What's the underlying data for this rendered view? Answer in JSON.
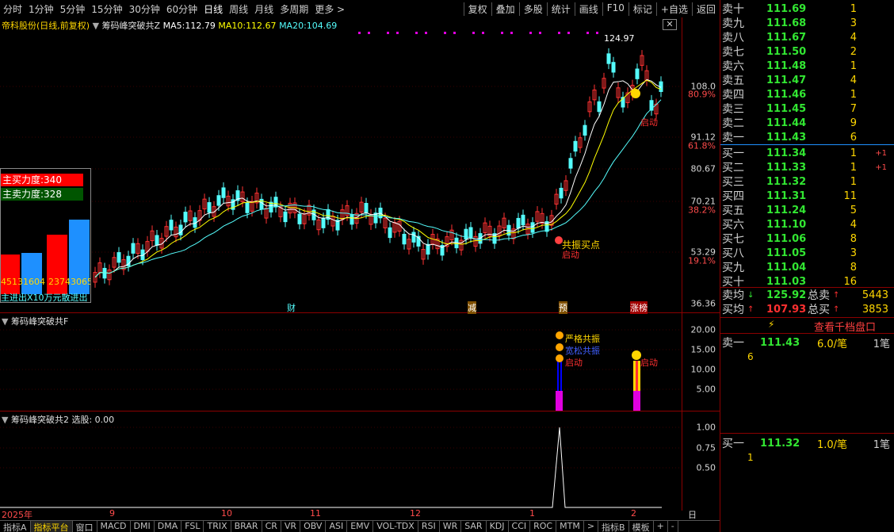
{
  "toolbar": {
    "left": [
      "分时",
      "1分钟",
      "5分钟",
      "15分钟",
      "30分钟",
      "60分钟",
      "日线",
      "周线",
      "月线",
      "多周期",
      "更多 >"
    ],
    "active": "日线",
    "right": [
      "复权",
      "叠加",
      "多股",
      "统计",
      "画线",
      "F10",
      "标记",
      "+自选",
      "返回"
    ]
  },
  "main_pane": {
    "title_stock": "帝科股份(日线,前复权)",
    "indicator": "筹码峰突破共Z",
    "ma5_label": "MA5:",
    "ma5": "112.79",
    "ma10_label": "MA10:",
    "ma10": "112.67",
    "ma20_label": "MA20:",
    "ma20": "104.69",
    "high_label": "124.97",
    "y_ticks": [
      "108.0",
      "91.12",
      "80.67",
      "70.21",
      "53.29",
      "36.36"
    ],
    "pct_ticks": [
      "80.9%",
      "61.8%",
      "38.2%",
      "19.1%"
    ],
    "power_box": {
      "buy_label": "主买力度:340",
      "sell_label": "主卖力度:328",
      "bottom_label": "主进出X10万元",
      "bottom_label2": "散进出",
      "bar_values": [
        "4513",
        "1604",
        "2374",
        "3065"
      ]
    },
    "annotations": {
      "buy_point": "共振买点",
      "start1": "启动",
      "start2": "启动"
    },
    "markers": [
      "财",
      "减",
      "预",
      "涨榜"
    ]
  },
  "sub_pane1": {
    "title": "筹码峰突破共F",
    "y_ticks": [
      "20.00",
      "15.00",
      "10.00",
      "5.00"
    ],
    "annotations": {
      "strict": "严格共振",
      "loose": "宽松共振",
      "start1": "启动",
      "start2": "启动"
    }
  },
  "sub_pane2": {
    "title": "筹码峰突破共2",
    "select_label": "选股: 0.00",
    "y_ticks": [
      "1.00",
      "0.75",
      "0.50"
    ]
  },
  "date_axis": [
    "2025年",
    "9",
    "10",
    "11",
    "12",
    "1",
    "2"
  ],
  "period_label": "日线",
  "bottom_tabs": [
    "指标A",
    "指标平台",
    "窗口",
    "MACD",
    "DMI",
    "DMA",
    "FSL",
    "TRIX",
    "BRAR",
    "CR",
    "VR",
    "OBV",
    "ASI",
    "EMV",
    "VOL-TDX",
    "RSI",
    "WR",
    "SAR",
    "KDJ",
    "CCI",
    "ROC",
    "MTM",
    ">",
    "指标B",
    "模板",
    "+",
    "-"
  ],
  "bottom_active": "指标平台",
  "orderbook": {
    "sells": [
      {
        "label": "卖十",
        "price": "111.69",
        "vol": "1"
      },
      {
        "label": "卖九",
        "price": "111.68",
        "vol": "3"
      },
      {
        "label": "卖八",
        "price": "111.67",
        "vol": "4"
      },
      {
        "label": "卖七",
        "price": "111.50",
        "vol": "2"
      },
      {
        "label": "卖六",
        "price": "111.48",
        "vol": "1"
      },
      {
        "label": "卖五",
        "price": "111.47",
        "vol": "4"
      },
      {
        "label": "卖四",
        "price": "111.46",
        "vol": "1"
      },
      {
        "label": "卖三",
        "price": "111.45",
        "vol": "7"
      },
      {
        "label": "卖二",
        "price": "111.44",
        "vol": "9"
      },
      {
        "label": "卖一",
        "price": "111.43",
        "vol": "6"
      }
    ],
    "buys": [
      {
        "label": "买一",
        "price": "111.34",
        "vol": "1",
        "chg": "+1"
      },
      {
        "label": "买二",
        "price": "111.33",
        "vol": "1",
        "chg": "+1"
      },
      {
        "label": "买三",
        "price": "111.32",
        "vol": "1",
        "chg": ""
      },
      {
        "label": "买四",
        "price": "111.31",
        "vol": "11",
        "chg": ""
      },
      {
        "label": "买五",
        "price": "111.24",
        "vol": "5",
        "chg": ""
      },
      {
        "label": "买六",
        "price": "111.10",
        "vol": "4",
        "chg": ""
      },
      {
        "label": "买七",
        "price": "111.06",
        "vol": "8",
        "chg": ""
      },
      {
        "label": "买八",
        "price": "111.05",
        "vol": "3",
        "chg": ""
      },
      {
        "label": "买九",
        "price": "111.04",
        "vol": "8",
        "chg": ""
      },
      {
        "label": "买十",
        "price": "111.03",
        "vol": "16",
        "chg": ""
      }
    ],
    "avg_sell_label": "卖均",
    "avg_sell": "125.92",
    "total_sell_label": "总卖",
    "total_sell": "5443",
    "avg_buy_label": "买均",
    "avg_buy": "107.93",
    "total_buy_label": "总买",
    "total_buy": "3853",
    "queue_button": "查看千档盘口",
    "queue_sell_label": "卖一",
    "queue_sell_price": "111.43",
    "queue_sell_per": "6.0/笔",
    "queue_sell_count": "1笔",
    "queue_sell_item": "6",
    "queue_buy_label": "买一",
    "queue_buy_price": "111.32",
    "queue_buy_per": "1.0/笔",
    "queue_buy_count": "1笔",
    "queue_buy_item": "1"
  },
  "colors": {
    "up": "#ff3232",
    "down": "#54fcfc",
    "ma5": "#ffffff",
    "ma10": "#ffff00",
    "ma20": "#54fcfc",
    "grid": "#8b0000"
  }
}
